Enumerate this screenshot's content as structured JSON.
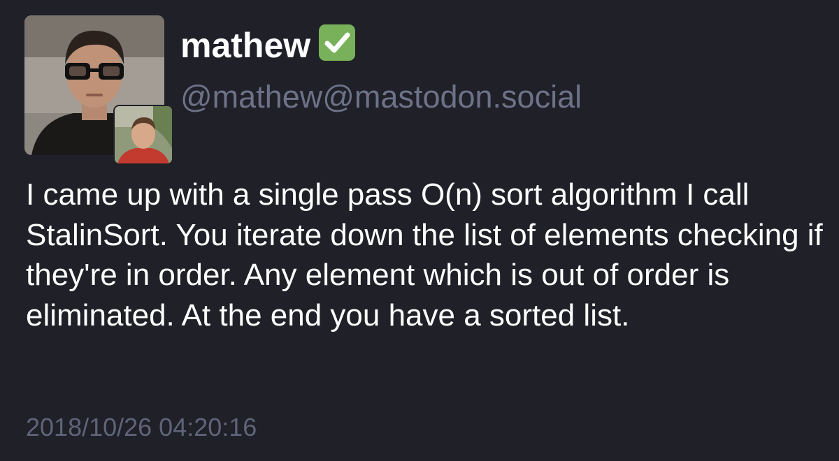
{
  "account": {
    "display_name": "mathew",
    "verified_emoji": "✅",
    "handle": "@mathew@mastodon.social"
  },
  "status": {
    "content": "I came up with a single pass O(n) sort algorithm I call StalinSort. You iterate down the list of elements checking if they're in order. Any element which is out of order is eliminated. At the end you have a sorted list.",
    "timestamp": "2018/10/26 04:20:16"
  },
  "icons": {
    "verified": "check-mark-button-icon"
  },
  "colors": {
    "background": "#1f2028",
    "text": "#ffffff",
    "handle": "#6d7288",
    "timestamp": "#5f6478",
    "verified_green": "#78b159"
  }
}
